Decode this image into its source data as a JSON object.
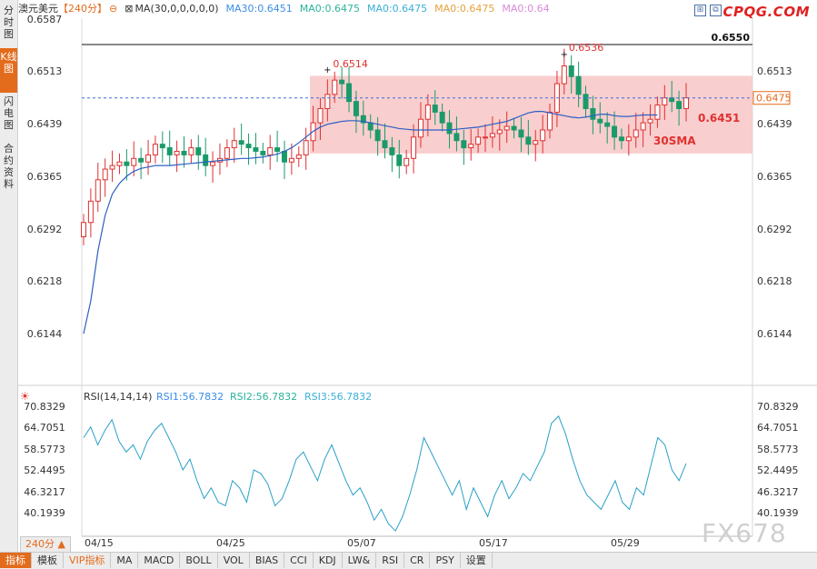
{
  "left_tabs": [
    "分时图",
    "K线图",
    "闪电图",
    "合约资料"
  ],
  "left_tab_active": 1,
  "header": {
    "symbol": "澳元美元",
    "period": "【240分】",
    "ma_params": "MA(30,0,0,0,0,0)",
    "ma_values": [
      {
        "label": "MA30:0.6451",
        "color": "#3a8ee6"
      },
      {
        "label": "MA0:0.6475",
        "color": "#2bb39a"
      },
      {
        "label": "MA0:0.6475",
        "color": "#3ab0d8"
      },
      {
        "label": "MA0:0.6475",
        "color": "#e6a23c"
      },
      {
        "label": "MA0:0.64",
        "color": "#d98ad8"
      }
    ]
  },
  "logo": "CPQG.COM",
  "watermark": "FX678",
  "colors": {
    "up": "#e03030",
    "down": "#1a9a6a",
    "ma30": "#2d5fc4",
    "rsi": "#2aa0c8",
    "range_fill": "#f8c6c6",
    "price_tag": "#e36b1c"
  },
  "price_axis": {
    "left_ticks": [
      "0.6587",
      "0.6513",
      "0.6439",
      "0.6365",
      "0.6292",
      "0.6218",
      "0.6144"
    ],
    "right_ticks": [
      "0.6513",
      "0.6439",
      "0.6365",
      "0.6292",
      "0.6218",
      "0.6144"
    ]
  },
  "annotations": {
    "resistance": "0.6550",
    "high1": "0.6514",
    "high2": "0.6536",
    "current_price": "0.6475",
    "ma30_value": "0.6451",
    "ma30_label": "30SMA"
  },
  "rsi": {
    "title": "RSI(14,14,14)",
    "values": [
      "RSI1:56.7832",
      "RSI2:56.7832",
      "RSI3:56.7832"
    ],
    "ticks": [
      "70.8329",
      "64.7051",
      "58.5773",
      "52.4495",
      "46.3217",
      "40.1939"
    ]
  },
  "dates": [
    "04/15",
    "04/25",
    "05/07",
    "05/17",
    "05/29"
  ],
  "period_button": "240分 ▲",
  "bottom_tabs": [
    "指标",
    "模板",
    "VIP指标",
    "MA",
    "MACD",
    "BOLL",
    "VOL",
    "BIAS",
    "CCI",
    "KDJ",
    "LW&",
    "RSI",
    "CR",
    "PSY",
    "设置"
  ],
  "bottom_tab_active": 0,
  "chart_data": [
    {
      "type": "candlestick",
      "title": "澳元美元 240分",
      "x_ticks": [
        "04/15",
        "04/25",
        "05/07",
        "05/17",
        "05/29"
      ],
      "ylim": [
        0.6144,
        0.6587
      ],
      "y_ticks": [
        0.6144,
        0.6218,
        0.6292,
        0.6365,
        0.6439,
        0.6513,
        0.6587
      ],
      "close_series": [
        0.63,
        0.633,
        0.636,
        0.6375,
        0.638,
        0.6385,
        0.638,
        0.639,
        0.6385,
        0.6395,
        0.641,
        0.6405,
        0.6395,
        0.64,
        0.6395,
        0.6405,
        0.6395,
        0.638,
        0.6385,
        0.639,
        0.6405,
        0.6415,
        0.641,
        0.6405,
        0.64,
        0.6395,
        0.6405,
        0.64,
        0.6385,
        0.639,
        0.6395,
        0.6415,
        0.644,
        0.646,
        0.648,
        0.65,
        0.6495,
        0.647,
        0.645,
        0.644,
        0.643,
        0.6415,
        0.6405,
        0.6395,
        0.638,
        0.639,
        0.642,
        0.6445,
        0.6465,
        0.6455,
        0.644,
        0.6425,
        0.6415,
        0.6405,
        0.641,
        0.642,
        0.642,
        0.6425,
        0.643,
        0.6435,
        0.643,
        0.642,
        0.641,
        0.6415,
        0.643,
        0.6455,
        0.6495,
        0.652,
        0.6505,
        0.648,
        0.646,
        0.6445,
        0.644,
        0.6435,
        0.642,
        0.6415,
        0.642,
        0.643,
        0.644,
        0.6445,
        0.6465,
        0.6475,
        0.647,
        0.646,
        0.6475
      ],
      "ma30_series": [
        0.6144,
        0.619,
        0.626,
        0.631,
        0.634,
        0.6355,
        0.6365,
        0.6372,
        0.6376,
        0.6378,
        0.638,
        0.638,
        0.638,
        0.6381,
        0.6382,
        0.6383,
        0.6384,
        0.6385,
        0.6386,
        0.6387,
        0.6388,
        0.6389,
        0.639,
        0.639,
        0.6391,
        0.6392,
        0.6394,
        0.6396,
        0.64,
        0.6405,
        0.6412,
        0.642,
        0.6428,
        0.6434,
        0.6438,
        0.644,
        0.6442,
        0.6443,
        0.6443,
        0.6442,
        0.644,
        0.6438,
        0.6436,
        0.6434,
        0.6432,
        0.6431,
        0.643,
        0.643,
        0.643,
        0.643,
        0.643,
        0.643,
        0.6431,
        0.6432,
        0.6433,
        0.6434,
        0.6436,
        0.6438,
        0.644,
        0.6442,
        0.6446,
        0.645,
        0.6454,
        0.6456,
        0.6456,
        0.6454,
        0.6452,
        0.645,
        0.6448,
        0.6447,
        0.6448,
        0.645,
        0.6452,
        0.6452,
        0.645,
        0.6449,
        0.6449,
        0.645,
        0.6451,
        0.6451,
        0.6451
      ],
      "range_box": [
        0.6397,
        0.6506
      ],
      "resistance": 0.655,
      "current": 0.6475
    },
    {
      "type": "line",
      "title": "RSI(14,14,14)",
      "ylim": [
        37.0,
        73.0
      ],
      "y_ticks": [
        40.1939,
        46.3217,
        52.4495,
        58.5773,
        64.7051,
        70.8329
      ],
      "values": [
        64,
        67,
        62,
        66,
        69,
        63,
        60,
        62,
        58,
        63,
        66,
        68,
        64,
        60,
        55,
        58,
        52,
        47,
        50,
        46,
        45,
        52,
        50,
        46,
        55,
        54,
        51,
        45,
        47,
        52,
        58,
        60,
        56,
        52,
        58,
        62,
        57,
        52,
        48,
        50,
        46,
        41,
        44,
        40,
        38,
        42,
        48,
        55,
        64,
        60,
        56,
        52,
        48,
        52,
        44,
        50,
        46,
        42,
        48,
        52,
        47,
        50,
        54,
        52,
        56,
        60,
        68,
        70,
        65,
        58,
        52,
        48,
        46,
        44,
        48,
        52,
        46,
        44,
        50,
        48,
        56,
        64,
        62,
        55,
        52,
        56.7832
      ]
    }
  ]
}
